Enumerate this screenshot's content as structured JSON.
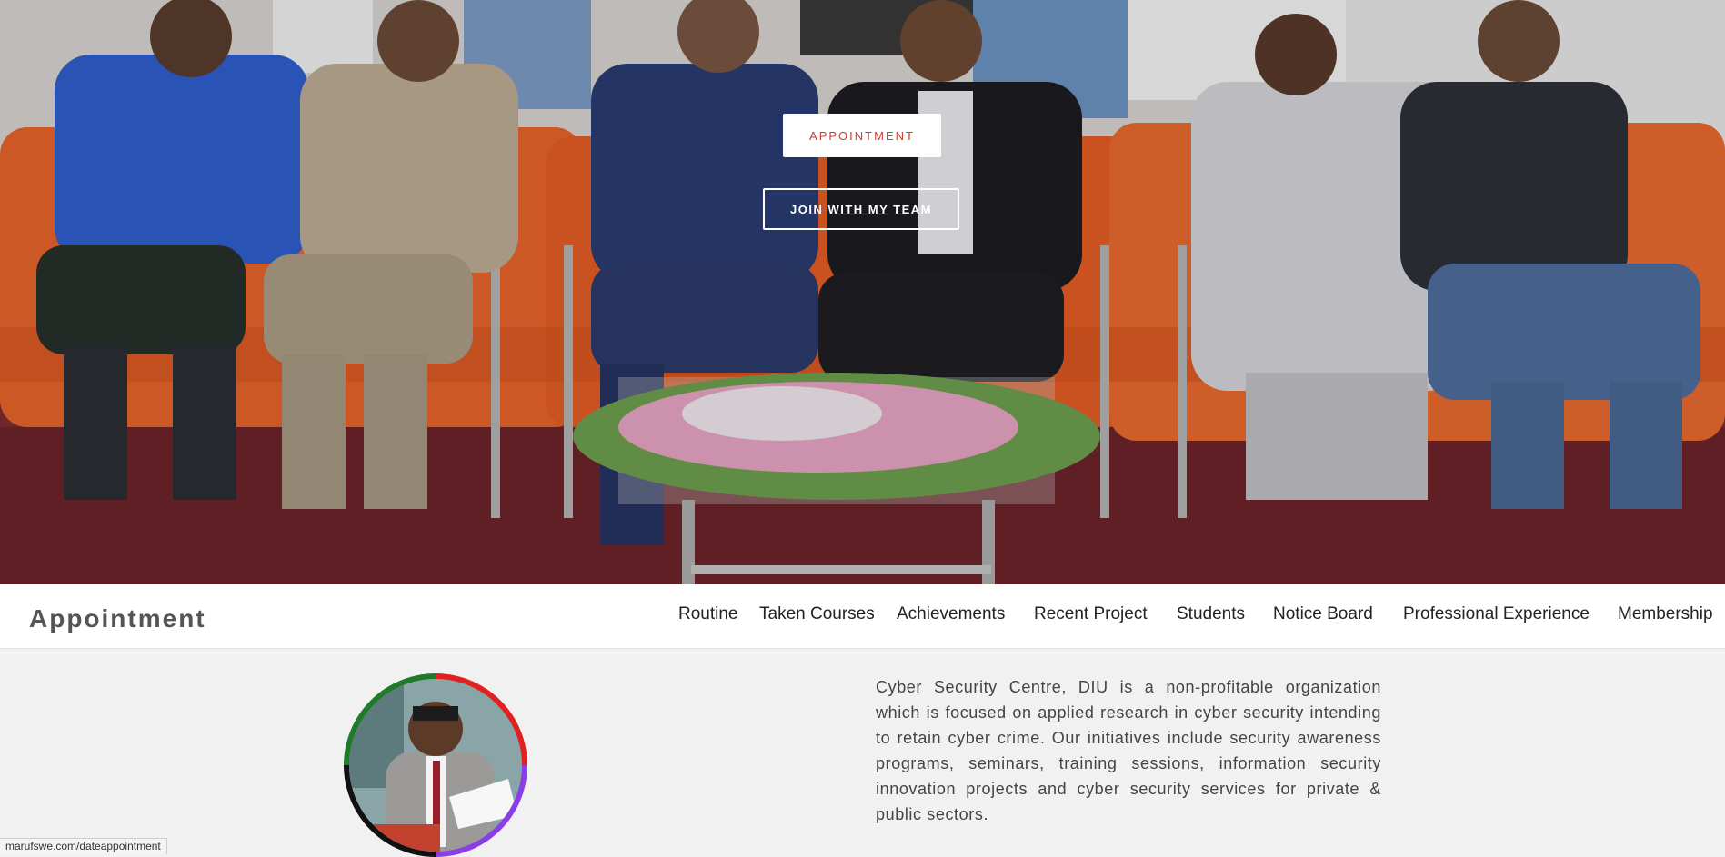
{
  "hero": {
    "photo_alt": "Group photo of people seated on orange sofas behind a flower arrangement",
    "appointment_button": "APPOINTMENT",
    "team_button": "JOIN WITH MY TEAM"
  },
  "navbar": {
    "brand": "Appointment",
    "items": [
      {
        "label": "Routine"
      },
      {
        "label": "Taken Courses"
      },
      {
        "label": "Achievements"
      },
      {
        "label": "Recent Project"
      },
      {
        "label": "Students"
      },
      {
        "label": "Notice Board"
      },
      {
        "label": "Professional Experience"
      },
      {
        "label": "Membership"
      }
    ]
  },
  "about": {
    "text": "Cyber Security Centre, DIU is a non-profitable organization which is focused on applied research in cyber security intending to retain cyber crime. Our initiatives include security awareness programs, seminars, training sessions, information security innovation projects and cyber security services for private & public sectors."
  },
  "status_bar": {
    "url": "marufswe.com/dateappointment"
  },
  "colors": {
    "accent": "#d13a2b",
    "sofa": "#ec6a2e",
    "carpet": "#7b2a30"
  }
}
